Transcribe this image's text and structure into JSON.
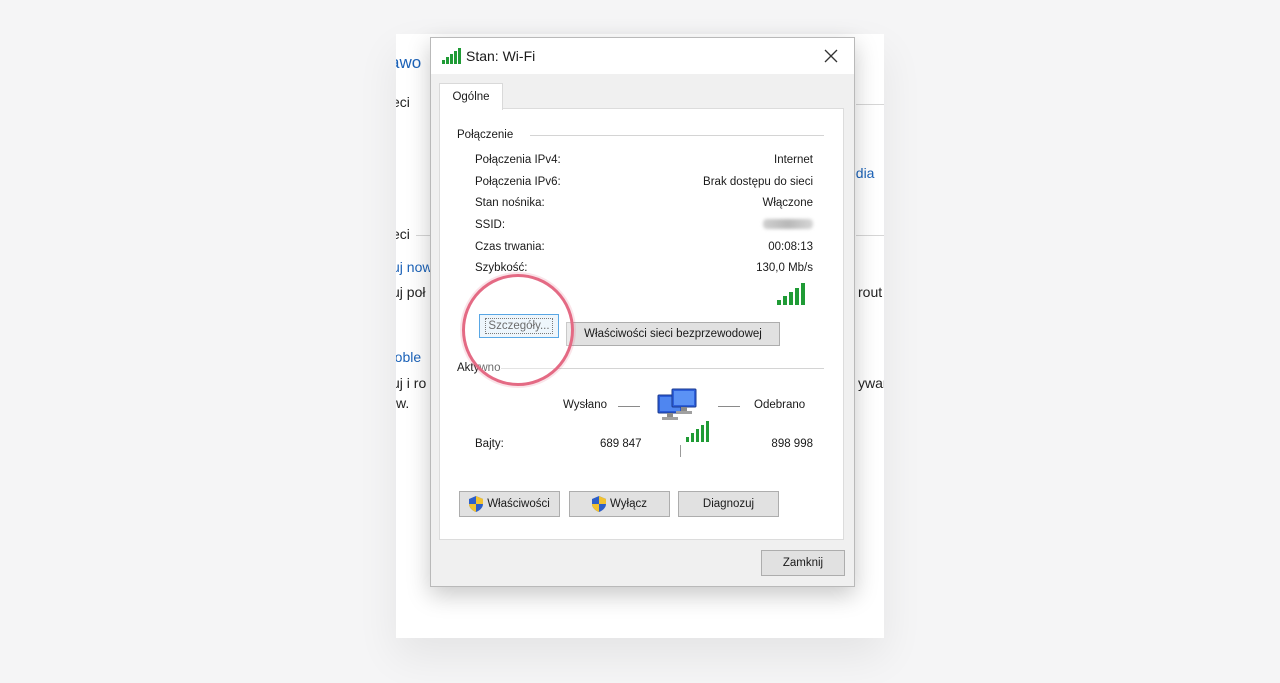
{
  "background_window": {
    "fragments": [
      "awo",
      "eci",
      "eci",
      "uj now",
      "uj poł",
      "roble",
      "uj i ro",
      "w.",
      "edia",
      "rout",
      "ywar"
    ]
  },
  "dialog": {
    "title": "Stan: Wi-Fi",
    "tab": "Ogólne",
    "connection": {
      "group_label": "Połączenie",
      "rows": [
        {
          "label": "Połączenia IPv4:",
          "value": "Internet"
        },
        {
          "label": "Połączenia IPv6:",
          "value": "Brak dostępu do sieci"
        },
        {
          "label": "Stan nośnika:",
          "value": "Włączone"
        },
        {
          "label": "SSID:",
          "value": ""
        },
        {
          "label": "Czas trwania:",
          "value": "00:08:13"
        },
        {
          "label": "Szybkość:",
          "value": "130,0 Mb/s"
        }
      ],
      "signal_bars": 5,
      "details_button": "Szczegóły...",
      "wireless_props_button": "Właściwości sieci bezprzewodowej"
    },
    "activity": {
      "group_label": "Aktywność",
      "sent_label": "Wysłano",
      "received_label": "Odebrano",
      "bytes_label": "Bajty:",
      "bytes_sent": "689 847",
      "bytes_received": "898 998"
    },
    "buttons": {
      "properties": "Właściwości",
      "disable": "Wyłącz",
      "diagnose": "Diagnozuj"
    },
    "close_button": "Zamknij"
  },
  "colors": {
    "signal": "#1f9b35",
    "highlight": "#e46a84",
    "link": "#1b62b8",
    "focus": "#0078d7"
  }
}
